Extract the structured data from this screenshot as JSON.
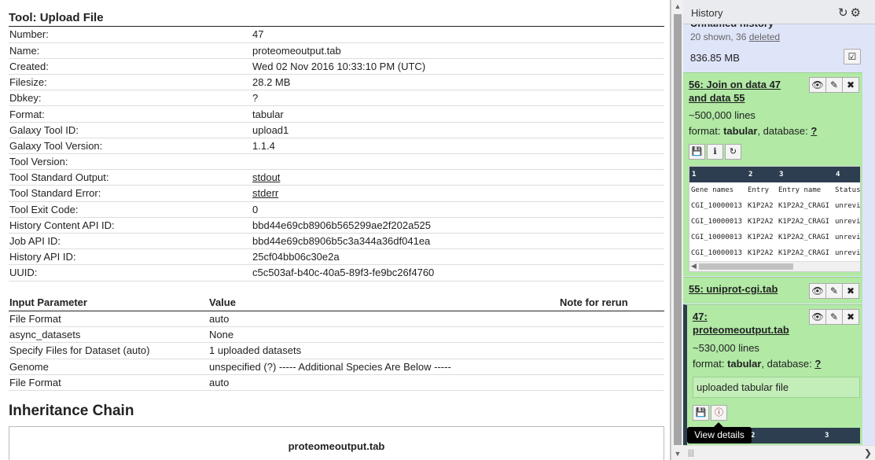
{
  "tool": {
    "title": "Tool: Upload File",
    "info": [
      {
        "key": "Number:",
        "value": "47"
      },
      {
        "key": "Name:",
        "value": "proteomeoutput.tab"
      },
      {
        "key": "Created:",
        "value": "Wed 02 Nov 2016 10:33:10 PM (UTC)"
      },
      {
        "key": "Filesize:",
        "value": "28.2 MB"
      },
      {
        "key": "Dbkey:",
        "value": "?"
      },
      {
        "key": "Format:",
        "value": "tabular"
      },
      {
        "key": "Galaxy Tool ID:",
        "value": "upload1"
      },
      {
        "key": "Galaxy Tool Version:",
        "value": "1.1.4"
      },
      {
        "key": "Tool Version:",
        "value": ""
      },
      {
        "key": "Tool Standard Output:",
        "value": "stdout"
      },
      {
        "key": "Tool Standard Error:",
        "value": "stderr"
      },
      {
        "key": "Tool Exit Code:",
        "value": "0"
      },
      {
        "key": "History Content API ID:",
        "value": "bbd44e69cb8906b565299ae2f202a525"
      },
      {
        "key": "Job API ID:",
        "value": "bbd44e69cb8906b5c3a344a36df041ea"
      },
      {
        "key": "History API ID:",
        "value": "25cf04bb06c30e2a"
      },
      {
        "key": "UUID:",
        "value": "c5c503af-b40c-40a5-89f3-fe9bc26f4760"
      }
    ]
  },
  "params": {
    "headers": {
      "param": "Input Parameter",
      "value": "Value",
      "note": "Note for rerun"
    },
    "rows": [
      {
        "param": "File Format",
        "value": "auto"
      },
      {
        "param": "async_datasets",
        "value": "None"
      },
      {
        "param": "Specify Files for Dataset (auto)",
        "value": "1 uploaded datasets"
      },
      {
        "param": "Genome",
        "value": "unspecified (?) ----- Additional Species Are Below -----"
      },
      {
        "param": "File Format",
        "value": "auto"
      }
    ]
  },
  "inheritance": {
    "title": "Inheritance Chain",
    "item": "proteomeoutput.tab"
  },
  "history": {
    "label": "History",
    "name": "Unnamed history",
    "shown": "20 shown, 36 ",
    "deleted": "deleted",
    "size": "836.85 MB",
    "datasets": [
      {
        "title_line1": "56: Join on data 47",
        "title_line2": "and data 55",
        "lines": "~500,000 lines",
        "format_label": "format: ",
        "format": "tabular",
        "database_label": ", database: ",
        "database": "?",
        "peek": {
          "header": [
            "1",
            "2",
            "3",
            "4"
          ],
          "columns": [
            "Gene names",
            "Entry",
            "Entry name",
            "Status"
          ],
          "rows": [
            [
              "CGI_10000013",
              "K1P2A2",
              "K1P2A2_CRAGI",
              "unrevi"
            ],
            [
              "CGI_10000013",
              "K1P2A2",
              "K1P2A2_CRAGI",
              "unrevi"
            ],
            [
              "CGI_10000013",
              "K1P2A2",
              "K1P2A2_CRAGI",
              "unrevi"
            ],
            [
              "CGI_10000013",
              "K1P2A2",
              "K1P2A2_CRAGI",
              "unrevi"
            ]
          ]
        }
      },
      {
        "title_line1": "55: uniprot-cgi.tab"
      },
      {
        "title_line1": "47:",
        "title_line2": "proteomeoutput.tab",
        "lines": "~530,000 lines",
        "format_label": "format: ",
        "format": "tabular",
        "database_label": ", database: ",
        "database": "?",
        "info": "uploaded tabular file",
        "peek_header": [
          "1",
          "2",
          "3"
        ]
      }
    ],
    "tooltip": "View details"
  },
  "icons": {
    "refresh": "refresh-icon",
    "gear": "gear-icon",
    "eye": "eye-icon",
    "pencil": "pencil-icon",
    "delete": "delete-icon",
    "save": "save-icon",
    "info": "info-icon",
    "rerun": "rerun-icon"
  }
}
